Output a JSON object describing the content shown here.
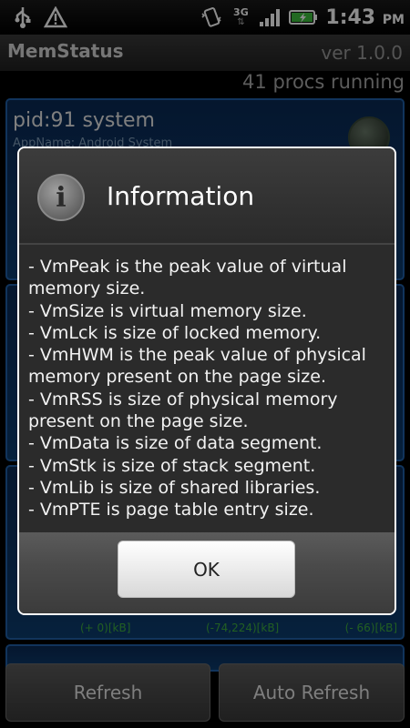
{
  "status_bar": {
    "time": "1:43",
    "ampm": "PM",
    "network": "3G",
    "icons": [
      "usb-icon",
      "warning-icon",
      "vibrate-icon",
      "3g-icon",
      "signal-icon",
      "battery-icon"
    ]
  },
  "app": {
    "title": "MemStatus",
    "version": "ver 1.0.0",
    "procs": "41 procs running"
  },
  "list": {
    "first_card": {
      "pid": "pid:91 system",
      "appname": "AppName: Android System"
    },
    "third_card": {
      "deltas": [
        "(+ 0)[kB]",
        "(-74,224)[kB]",
        "(- 66)[kB]"
      ]
    }
  },
  "buttons": {
    "refresh": "Refresh",
    "auto_refresh": "Auto Refresh"
  },
  "dialog": {
    "title": "Information",
    "lines": [
      "- VmPeak is the peak value of virtual memory size.",
      "- VmSize is virtual memory size.",
      "- VmLck is size of locked memory.",
      "- VmHWM is the peak value of physical memory present on the page size.",
      "- VmRSS is size of physical memory present on the page size.",
      "- VmData is size of data segment.",
      "- VmStk is size of stack segment.",
      "- VmLib is size of shared libraries.",
      "- VmPTE is page table entry size."
    ],
    "ok_label": "OK"
  },
  "colors": {
    "card_border": "#1f5fa8",
    "card_fill": "#0c3c6e",
    "delta_green": "#3fae3f"
  }
}
